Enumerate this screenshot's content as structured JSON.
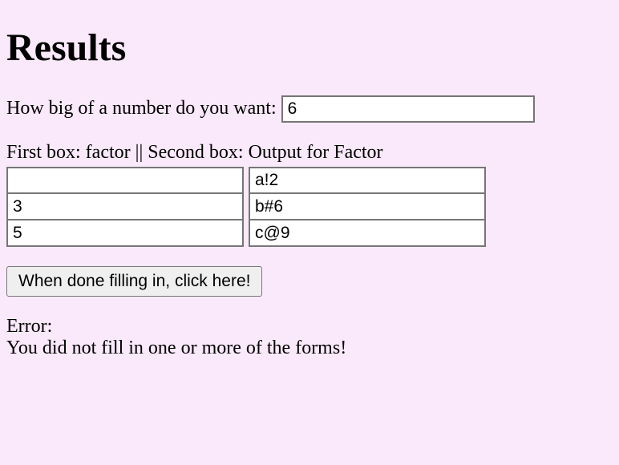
{
  "heading": "Results",
  "prompt": "How big of a number do you want: ",
  "number_value": "6",
  "instructions": "First box: factor || Second box: Output for Factor",
  "rows": [
    {
      "factor": "",
      "output": "a!2"
    },
    {
      "factor": "3",
      "output": "b#6"
    },
    {
      "factor": "5",
      "output": "c@9"
    }
  ],
  "button_label": "When done filling in, click here!",
  "error_label": "Error:",
  "error_message": "You did not fill in one or more of the forms!"
}
